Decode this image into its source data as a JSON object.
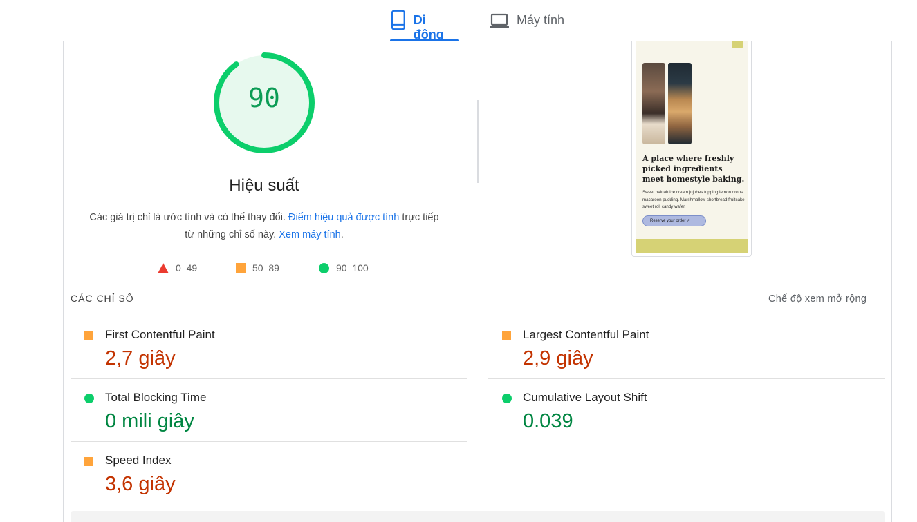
{
  "tabs": {
    "mobile": {
      "label": "Di động",
      "icon": "phone-icon",
      "active": true
    },
    "desktop": {
      "label": "Máy tính",
      "icon": "laptop-icon",
      "active": false
    }
  },
  "gauge": {
    "score": "90",
    "score_fraction": 0.9,
    "title": "Hiệu suất",
    "color": "#0cce6b"
  },
  "description": {
    "text1": "Các giá trị chỉ là ước tính và có thể thay đổi.",
    "link1": "Điểm hiệu quả được tính",
    "text2": "trực tiếp từ những chỉ số này.",
    "link2": "Xem máy tính",
    "text3": "."
  },
  "legend": {
    "fail": {
      "label": "0–49",
      "color": "#eb3b2f",
      "icon": "triangle-icon"
    },
    "average": {
      "label": "50–89",
      "color": "#ffa43b",
      "icon": "square-icon"
    },
    "pass": {
      "label": "90–100",
      "color": "#0cce6b",
      "icon": "circle-icon"
    }
  },
  "preview": {
    "heading": "A place where freshly picked ingredients meet homestyle baking.",
    "body": "Sweet haluah ice cream jujubes topping lemon drops macaroon pudding. Marshmallow shortbread fruitcake sweet roll candy wafer.",
    "button": "Reserve your order ↗"
  },
  "metrics": {
    "header": "CÁC CHỈ SỐ",
    "expand_label": "Chế độ xem mở rộng",
    "items": [
      {
        "name": "First Contentful Paint",
        "value": "2,7 giây",
        "rating": "average"
      },
      {
        "name": "Largest Contentful Paint",
        "value": "2,9 giây",
        "rating": "average"
      },
      {
        "name": "Total Blocking Time",
        "value": "0 mili giây",
        "rating": "pass"
      },
      {
        "name": "Cumulative Layout Shift",
        "value": "0.039",
        "rating": "pass"
      },
      {
        "name": "Speed Index",
        "value": "3,6 giây",
        "rating": "average"
      }
    ]
  },
  "colors": {
    "accent": "#1a73e8",
    "average_text": "#c33300",
    "pass_text": "#018642"
  }
}
